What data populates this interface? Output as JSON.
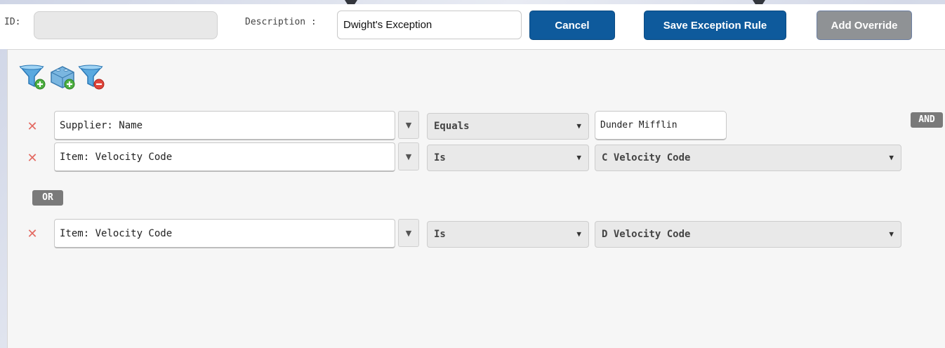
{
  "header": {
    "id_label": "ID:",
    "id_value": "",
    "description_label": "Description :",
    "description_value": "Dwight's Exception",
    "cancel_label": "Cancel",
    "save_label": "Save Exception Rule",
    "add_override_label": "Add Override"
  },
  "toolbar": {
    "icons": [
      "filter-add-icon",
      "block-add-icon",
      "filter-remove-icon"
    ]
  },
  "groups": [
    {
      "rules": [
        {
          "field": "Supplier: Name",
          "operator": "Equals",
          "value": "Dunder Mifflin"
        },
        {
          "field": "Item: Velocity Code",
          "operator": "Is",
          "value": "C Velocity Code"
        }
      ],
      "connector": "AND"
    },
    {
      "rules": [
        {
          "field": "Item: Velocity Code",
          "operator": "Is",
          "value": "D Velocity Code"
        }
      ]
    }
  ],
  "group_separator": "OR",
  "colors": {
    "primary_button": "#0e5a9c",
    "disabled_button": "#8f9295",
    "delete_icon": "#e36a62",
    "badge": "#7a7a7a"
  }
}
